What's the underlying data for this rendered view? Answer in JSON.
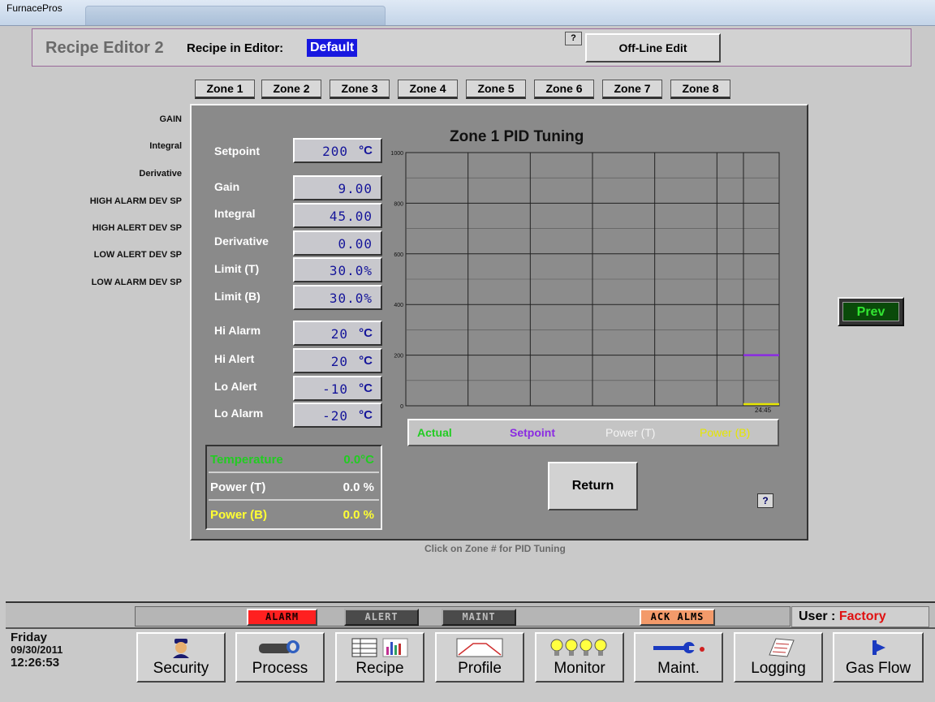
{
  "window": {
    "app_name": "FurnacePros"
  },
  "header": {
    "title": "Recipe Editor 2",
    "recipe_label": "Recipe in Editor:",
    "recipe_name": "Default",
    "help_label": "?",
    "offline_edit_label": "Off-Line Edit"
  },
  "zone_tabs": [
    "Zone 1",
    "Zone 2",
    "Zone 3",
    "Zone 4",
    "Zone 5",
    "Zone 6",
    "Zone 7",
    "Zone 8"
  ],
  "side_labels": [
    "GAIN",
    "Integral",
    "Derivative",
    "HIGH ALARM DEV SP",
    "HIGH ALERT DEV SP",
    "LOW ALERT DEV SP",
    "LOW ALARM DEV SP"
  ],
  "pid": {
    "chart_title": "Zone 1 PID Tuning",
    "setpoint": {
      "label": "Setpoint",
      "value": "200",
      "unit": "°C"
    },
    "gain": {
      "label": "Gain",
      "value": "9.00"
    },
    "integral": {
      "label": "Integral",
      "value": "45.00"
    },
    "derivative": {
      "label": "Derivative",
      "value": "0.00"
    },
    "limit_t": {
      "label": "Limit (T)",
      "value": "30.0%"
    },
    "limit_b": {
      "label": "Limit (B)",
      "value": "30.0%"
    },
    "hi_alarm": {
      "label": "Hi Alarm",
      "value": "20",
      "unit": "°C"
    },
    "hi_alert": {
      "label": "Hi Alert",
      "value": "20",
      "unit": "°C"
    },
    "lo_alert": {
      "label": "Lo Alert",
      "value": "-10",
      "unit": "°C"
    },
    "lo_alarm": {
      "label": "Lo Alarm",
      "value": "-20",
      "unit": "°C"
    },
    "legend": {
      "actual": "Actual",
      "setpoint": "Setpoint",
      "power_t": "Power (T)",
      "power_b": "Power (B)"
    },
    "readouts": {
      "temperature": {
        "label": "Temperature",
        "value": "0.0°C"
      },
      "power_t": {
        "label": "Power (T)",
        "value": "0.0 %"
      },
      "power_b": {
        "label": "Power (B)",
        "value": "0.0 %"
      }
    },
    "return_label": "Return",
    "help_label": "?"
  },
  "chart_data": {
    "type": "line",
    "title": "Zone 1 PID Tuning",
    "ylim": [
      0,
      1000
    ],
    "y_ticks": [
      "0",
      "200",
      "400",
      "600",
      "800",
      "1000"
    ],
    "x_tick_label": "24:45",
    "grid": true,
    "series": [
      {
        "name": "Setpoint",
        "color": "#8a2be2",
        "values": [
          200
        ]
      },
      {
        "name": "Power (B)",
        "color": "#e6e600",
        "values": [
          0
        ]
      }
    ]
  },
  "hint_text": "Click on Zone # for PID Tuning",
  "prev_label": "Prev",
  "status": {
    "alarm": "ALARM",
    "alert": "ALERT",
    "maint": "MAINT",
    "ack": "ACK ALMS",
    "user_label": "User :",
    "user_name": "Factory"
  },
  "datetime": {
    "day": "Friday",
    "date": "09/30/2011",
    "time": "12:26:53"
  },
  "nav": [
    "Security",
    "Process",
    "Recipe",
    "Profile",
    "Monitor",
    "Maint.",
    "Logging",
    "Gas Flow"
  ],
  "colors": {
    "actual": "#22cc22",
    "setpoint": "#8a2be2",
    "power_b": "#e6e600",
    "alarm": "#ff2020",
    "user_name": "#e01010"
  }
}
